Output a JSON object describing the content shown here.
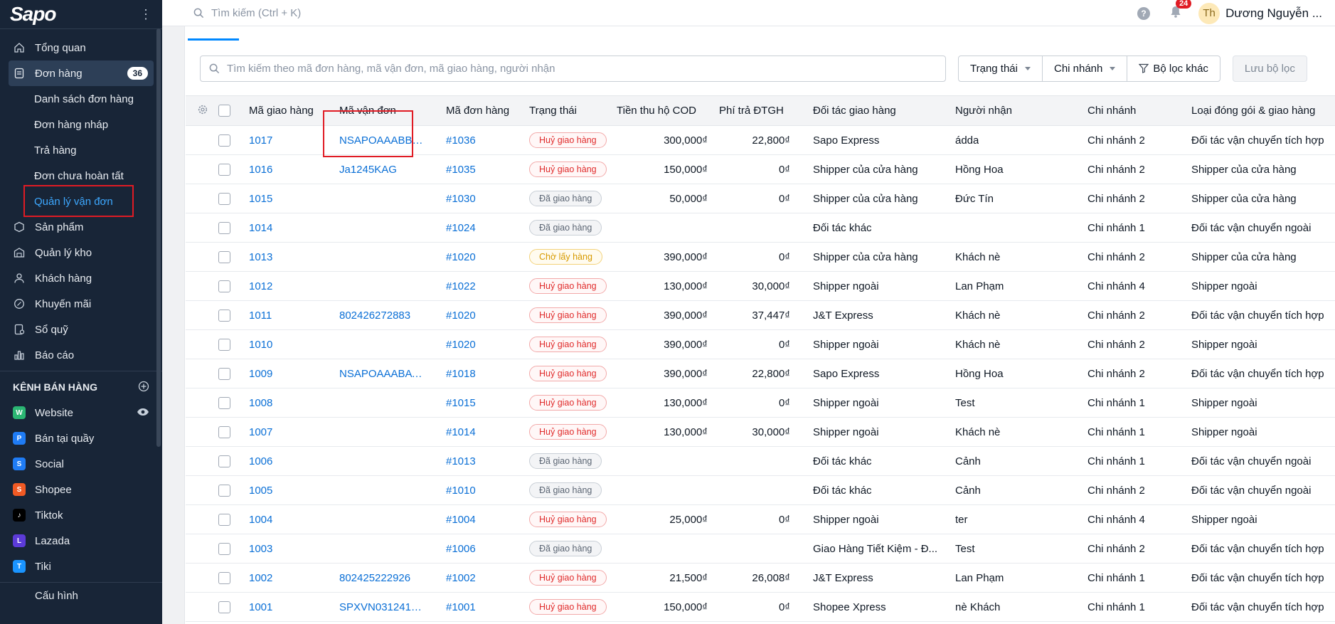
{
  "sidebar": {
    "logo": "Sapo",
    "nav": [
      {
        "label": "Tổng quan",
        "icon": "home-icon"
      },
      {
        "label": "Đơn hàng",
        "icon": "order-icon",
        "badge": "36",
        "active": true
      },
      {
        "label": "Sản phẩm",
        "icon": "product-icon"
      },
      {
        "label": "Quản lý kho",
        "icon": "warehouse-icon"
      },
      {
        "label": "Khách hàng",
        "icon": "customer-icon"
      },
      {
        "label": "Khuyến mãi",
        "icon": "promotion-icon"
      },
      {
        "label": "Sổ quỹ",
        "icon": "cashbook-icon"
      },
      {
        "label": "Báo cáo",
        "icon": "report-icon"
      }
    ],
    "order_sub": [
      "Danh sách đơn hàng",
      "Đơn hàng nháp",
      "Trả hàng",
      "Đơn chưa hoàn tất",
      "Quản lý vận đơn"
    ],
    "sales_channel_title": "KÊNH BÁN HÀNG",
    "channels": [
      {
        "label": "Website",
        "color": "#2bb673",
        "glyph": "W"
      },
      {
        "label": "Bán tại quầy",
        "color": "#1f7cf5",
        "glyph": "P"
      },
      {
        "label": "Social",
        "color": "#1f7cf5",
        "glyph": "S"
      },
      {
        "label": "Shopee",
        "color": "#f15a24",
        "glyph": "S"
      },
      {
        "label": "Tiktok",
        "color": "#000000",
        "glyph": "♪"
      },
      {
        "label": "Lazada",
        "color": "#5c3bd8",
        "glyph": "L"
      },
      {
        "label": "Tiki",
        "color": "#1a94ff",
        "glyph": "T"
      }
    ],
    "bottom_partial": "Cấu hình"
  },
  "topbar": {
    "search_placeholder": "Tìm kiếm (Ctrl + K)",
    "notification_count": "24",
    "avatar_initials": "Th",
    "user_name": "Dương Nguyễn ..."
  },
  "filters": {
    "search_placeholder": "Tìm kiếm theo mã đơn hàng, mã vận đơn, mã giao hàng, người nhận",
    "status": "Trạng thái",
    "branch": "Chi nhánh",
    "other": "Bộ lọc khác",
    "save": "Lưu bộ lọc"
  },
  "table": {
    "headers": [
      "Mã giao hàng",
      "Mã vận đơn",
      "Mã đơn hàng",
      "Trạng thái",
      "Tiền thu hộ COD",
      "Phí trả ĐTGH",
      "Đối tác giao hàng",
      "Người nhận",
      "Chi nhánh",
      "Loại đóng gói & giao hàng"
    ],
    "rows": [
      {
        "code": "1017",
        "tracking": "NSAPOAAABBJ...",
        "order": "#1036",
        "status": "Huỷ giao hàng",
        "status_type": "red",
        "cod": "300,000₫",
        "fee": "22,800₫",
        "partner": "Sapo Express",
        "receiver": "ádda",
        "branch": "Chi nhánh 2",
        "type": "Đối tác vận chuyển tích hợp"
      },
      {
        "code": "1016",
        "tracking": "Ja1245KAG",
        "order": "#1035",
        "status": "Huỷ giao hàng",
        "status_type": "red",
        "cod": "150,000₫",
        "fee": "0₫",
        "partner": "Shipper của cửa hàng",
        "receiver": "Hồng Hoa",
        "branch": "Chi nhánh 2",
        "type": "Shipper của cửa hàng"
      },
      {
        "code": "1015",
        "tracking": "",
        "order": "#1030",
        "status": "Đã giao hàng",
        "status_type": "grey",
        "cod": "50,000₫",
        "fee": "0₫",
        "partner": "Shipper của cửa hàng",
        "receiver": "Đức Tín",
        "branch": "Chi nhánh 2",
        "type": "Shipper của cửa hàng"
      },
      {
        "code": "1014",
        "tracking": "",
        "order": "#1024",
        "status": "Đã giao hàng",
        "status_type": "grey",
        "cod": "",
        "fee": "",
        "partner": "Đối tác khác",
        "receiver": "",
        "branch": "Chi nhánh 1",
        "type": "Đối tác vận chuyển ngoài"
      },
      {
        "code": "1013",
        "tracking": "",
        "order": "#1020",
        "status": "Chờ lấy hàng",
        "status_type": "yellow",
        "cod": "390,000₫",
        "fee": "0₫",
        "partner": "Shipper của cửa hàng",
        "receiver": "Khách nè",
        "branch": "Chi nhánh 2",
        "type": "Shipper của cửa hàng"
      },
      {
        "code": "1012",
        "tracking": "",
        "order": "#1022",
        "status": "Huỷ giao hàng",
        "status_type": "red",
        "cod": "130,000₫",
        "fee": "30,000₫",
        "partner": "Shipper ngoài",
        "receiver": "Lan Phạm",
        "branch": "Chi nhánh 4",
        "type": "Shipper ngoài"
      },
      {
        "code": "1011",
        "tracking": "802426272883",
        "order": "#1020",
        "status": "Huỷ giao hàng",
        "status_type": "red",
        "cod": "390,000₫",
        "fee": "37,447₫",
        "partner": "J&T Express",
        "receiver": "Khách nè",
        "branch": "Chi nhánh 2",
        "type": "Đối tác vận chuyển tích hợp"
      },
      {
        "code": "1010",
        "tracking": "",
        "order": "#1020",
        "status": "Huỷ giao hàng",
        "status_type": "red",
        "cod": "390,000₫",
        "fee": "0₫",
        "partner": "Shipper ngoài",
        "receiver": "Khách nè",
        "branch": "Chi nhánh 2",
        "type": "Shipper ngoài"
      },
      {
        "code": "1009",
        "tracking": "NSAPOAAABAV...",
        "order": "#1018",
        "status": "Huỷ giao hàng",
        "status_type": "red",
        "cod": "390,000₫",
        "fee": "22,800₫",
        "partner": "Sapo Express",
        "receiver": "Hồng Hoa",
        "branch": "Chi nhánh 2",
        "type": "Đối tác vận chuyển tích hợp"
      },
      {
        "code": "1008",
        "tracking": "",
        "order": "#1015",
        "status": "Huỷ giao hàng",
        "status_type": "red",
        "cod": "130,000₫",
        "fee": "0₫",
        "partner": "Shipper ngoài",
        "receiver": "Test",
        "branch": "Chi nhánh 1",
        "type": "Shipper ngoài"
      },
      {
        "code": "1007",
        "tracking": "",
        "order": "#1014",
        "status": "Huỷ giao hàng",
        "status_type": "red",
        "cod": "130,000₫",
        "fee": "30,000₫",
        "partner": "Shipper ngoài",
        "receiver": "Khách nè",
        "branch": "Chi nhánh 1",
        "type": "Shipper ngoài"
      },
      {
        "code": "1006",
        "tracking": "",
        "order": "#1013",
        "status": "Đã giao hàng",
        "status_type": "grey",
        "cod": "",
        "fee": "",
        "partner": "Đối tác khác",
        "receiver": "Cảnh",
        "branch": "Chi nhánh 1",
        "type": "Đối tác vận chuyển ngoài"
      },
      {
        "code": "1005",
        "tracking": "",
        "order": "#1010",
        "status": "Đã giao hàng",
        "status_type": "grey",
        "cod": "",
        "fee": "",
        "partner": "Đối tác khác",
        "receiver": "Cảnh",
        "branch": "Chi nhánh 2",
        "type": "Đối tác vận chuyển ngoài"
      },
      {
        "code": "1004",
        "tracking": "",
        "order": "#1004",
        "status": "Huỷ giao hàng",
        "status_type": "red",
        "cod": "25,000₫",
        "fee": "0₫",
        "partner": "Shipper ngoài",
        "receiver": "ter",
        "branch": "Chi nhánh 4",
        "type": "Shipper ngoài"
      },
      {
        "code": "1003",
        "tracking": "",
        "order": "#1006",
        "status": "Đã giao hàng",
        "status_type": "grey",
        "cod": "",
        "fee": "",
        "partner": "Giao Hàng Tiết Kiệm - Đ...",
        "receiver": "Test",
        "branch": "Chi nhánh 2",
        "type": "Đối tác vận chuyển tích hợp"
      },
      {
        "code": "1002",
        "tracking": "802425222926",
        "order": "#1002",
        "status": "Huỷ giao hàng",
        "status_type": "red",
        "cod": "21,500₫",
        "fee": "26,008₫",
        "partner": "J&T Express",
        "receiver": "Lan Phạm",
        "branch": "Chi nhánh 1",
        "type": "Đối tác vận chuyển tích hợp"
      },
      {
        "code": "1001",
        "tracking": "SPXVN0312413...",
        "order": "#1001",
        "status": "Huỷ giao hàng",
        "status_type": "red",
        "cod": "150,000₫",
        "fee": "0₫",
        "partner": "Shopee Xpress",
        "receiver": "nè Khách",
        "branch": "Chi nhánh 1",
        "type": "Đối tác vận chuyển tích hợp"
      }
    ]
  }
}
